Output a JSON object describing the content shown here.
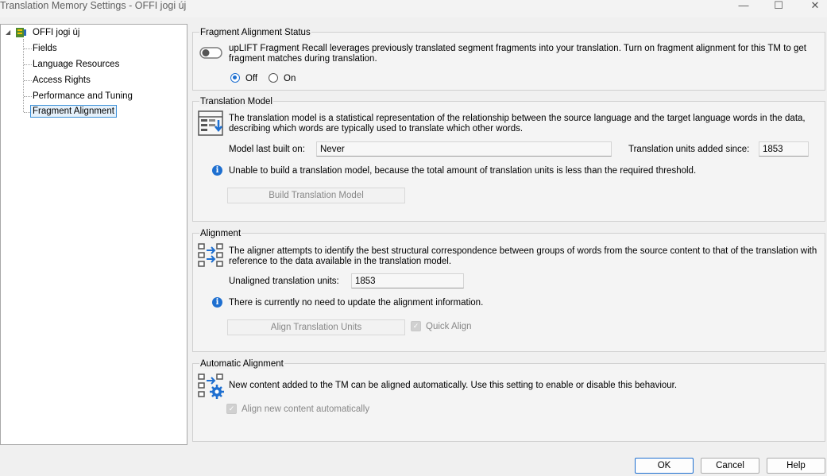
{
  "window": {
    "title": "Translation Memory Settings - OFFI jogi új",
    "controls": [
      "minimize",
      "maximize",
      "close"
    ]
  },
  "tree": {
    "root": "OFFI jogi új",
    "items": [
      {
        "label": "Fields",
        "selected": false
      },
      {
        "label": "Language Resources",
        "selected": false
      },
      {
        "label": "Access Rights",
        "selected": false
      },
      {
        "label": "Performance and Tuning",
        "selected": false
      },
      {
        "label": "Fragment Alignment",
        "selected": true
      }
    ]
  },
  "fragment_status": {
    "title": "Fragment Alignment Status",
    "description": "upLIFT Fragment Recall leverages previously translated segment fragments into your translation. Turn on fragment alignment for this TM to get fragment matches during translation.",
    "off_label": "Off",
    "on_label": "On",
    "selected": "Off"
  },
  "translation_model": {
    "title": "Translation Model",
    "description": "The translation model is a statistical representation of the relationship between the source language and the target language words in the data, describing which words are typically used to translate which other words.",
    "last_built_label": "Model last built on:",
    "last_built_value": "Never",
    "units_added_label": "Translation units added since:",
    "units_added_value": "1853",
    "info_text": "Unable to build a translation model, because the total amount of translation units is less than the required threshold.",
    "build_button": "Build Translation Model"
  },
  "alignment": {
    "title": "Alignment",
    "description": "The aligner attempts to identify the best structural correspondence between groups of words from the source content to that of the translation with reference to the data available in the translation model.",
    "unaligned_label": "Unaligned translation units:",
    "unaligned_value": "1853",
    "info_text": "There is currently no need to update the alignment information.",
    "align_button": "Align Translation Units",
    "quick_align_label": "Quick Align",
    "quick_align_checked": true
  },
  "automatic_alignment": {
    "title": "Automatic Alignment",
    "description": "New content added to the TM can be aligned automatically. Use this setting to enable or disable this behaviour.",
    "checkbox_label": "Align new content automatically",
    "checked": true
  },
  "footer": {
    "ok": "OK",
    "cancel": "Cancel",
    "help": "Help"
  },
  "colors": {
    "accent": "#1e6fd0",
    "selection_border": "#3a8fd8",
    "selection_bg": "#e5f1fb"
  }
}
